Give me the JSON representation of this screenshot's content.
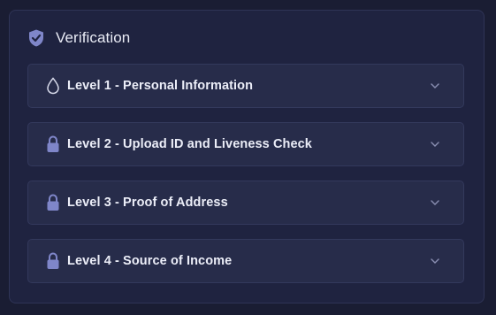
{
  "panel": {
    "title": "Verification",
    "icon": "shield-check-icon"
  },
  "levels": [
    {
      "label": "Level 1 - Personal Information",
      "icon": "drop-icon"
    },
    {
      "label": "Level 2 - Upload ID and Liveness Check",
      "icon": "lock-icon"
    },
    {
      "label": "Level 3 - Proof of Address",
      "icon": "lock-icon"
    },
    {
      "label": "Level 4 - Source of Income",
      "icon": "lock-icon"
    }
  ],
  "colors": {
    "background": "#1a1d33",
    "panel": "#1f2340",
    "row": "#272c4a",
    "accent": "#7f86c9",
    "text": "#eceef8"
  }
}
